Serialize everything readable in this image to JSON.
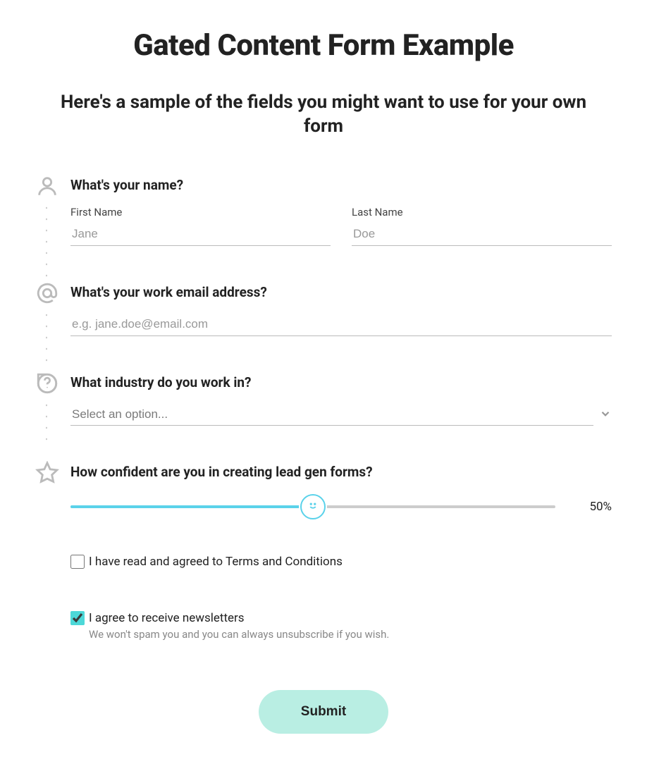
{
  "title": "Gated Content Form Example",
  "intro": "Here's a sample of the fields you might want to use for your own form",
  "fields": {
    "name": {
      "label": "What's your name?",
      "first_label": "First Name",
      "first_placeholder": "Jane",
      "last_label": "Last Name",
      "last_placeholder": "Doe"
    },
    "email": {
      "label": "What's your work email address?",
      "placeholder": "e.g. jane.doe@email.com"
    },
    "industry": {
      "label": "What industry do you work in?",
      "placeholder": "Select an option..."
    },
    "confidence": {
      "label": "How confident are you in creating lead gen forms?",
      "value_text": "50%",
      "value_pct": 50
    }
  },
  "terms": {
    "checked": false,
    "label": "I have read and agreed to Terms and Conditions"
  },
  "newsletter": {
    "checked": true,
    "label": "I agree to receive newsletters",
    "sub": "We won't spam you and you can always unsubscribe if you wish."
  },
  "submit_label": "Submit"
}
